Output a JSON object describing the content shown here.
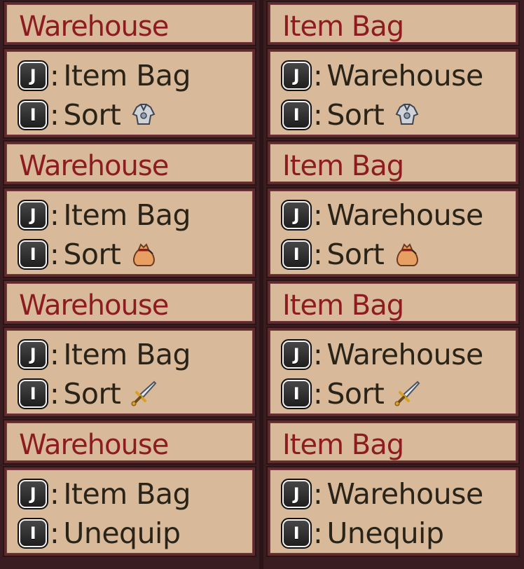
{
  "groups": [
    {
      "left": {
        "title": "Warehouse",
        "row1_key": "J",
        "row1_sep": ":",
        "row1_label": "Item Bag",
        "row2_key": "I",
        "row2_sep": ":",
        "row2_label": "Sort",
        "icon": "armor-icon"
      },
      "right": {
        "title": "Item Bag",
        "row1_key": "J",
        "row1_sep": ":",
        "row1_label": "Warehouse",
        "row2_key": "I",
        "row2_sep": ":",
        "row2_label": "Sort",
        "icon": "armor-icon"
      }
    },
    {
      "left": {
        "title": "Warehouse",
        "row1_key": "J",
        "row1_sep": ":",
        "row1_label": "Item Bag",
        "row2_key": "I",
        "row2_sep": ":",
        "row2_label": "Sort",
        "icon": "pouch-icon"
      },
      "right": {
        "title": "Item Bag",
        "row1_key": "J",
        "row1_sep": ":",
        "row1_label": "Warehouse",
        "row2_key": "I",
        "row2_sep": ":",
        "row2_label": "Sort",
        "icon": "pouch-icon"
      }
    },
    {
      "left": {
        "title": "Warehouse",
        "row1_key": "J",
        "row1_sep": ":",
        "row1_label": "Item Bag",
        "row2_key": "I",
        "row2_sep": ":",
        "row2_label": "Sort",
        "icon": "sword-icon"
      },
      "right": {
        "title": "Item Bag",
        "row1_key": "J",
        "row1_sep": ":",
        "row1_label": "Warehouse",
        "row2_key": "I",
        "row2_sep": ":",
        "row2_label": "Sort",
        "icon": "sword-icon"
      }
    },
    {
      "left": {
        "title": "Warehouse",
        "row1_key": "J",
        "row1_sep": ":",
        "row1_label": "Item Bag",
        "row2_key": "I",
        "row2_sep": ":",
        "row2_label": "Unequip",
        "icon": ""
      },
      "right": {
        "title": "Item Bag",
        "row1_key": "J",
        "row1_sep": ":",
        "row1_label": "Warehouse",
        "row2_key": "I",
        "row2_sep": ":",
        "row2_label": "Unequip",
        "icon": ""
      }
    }
  ],
  "colors": {
    "title": "#8c1c1f",
    "text": "#2a2418",
    "panel_bg": "#d8b99a",
    "frame": "#5e2a2e",
    "background": "#3a1d20"
  }
}
